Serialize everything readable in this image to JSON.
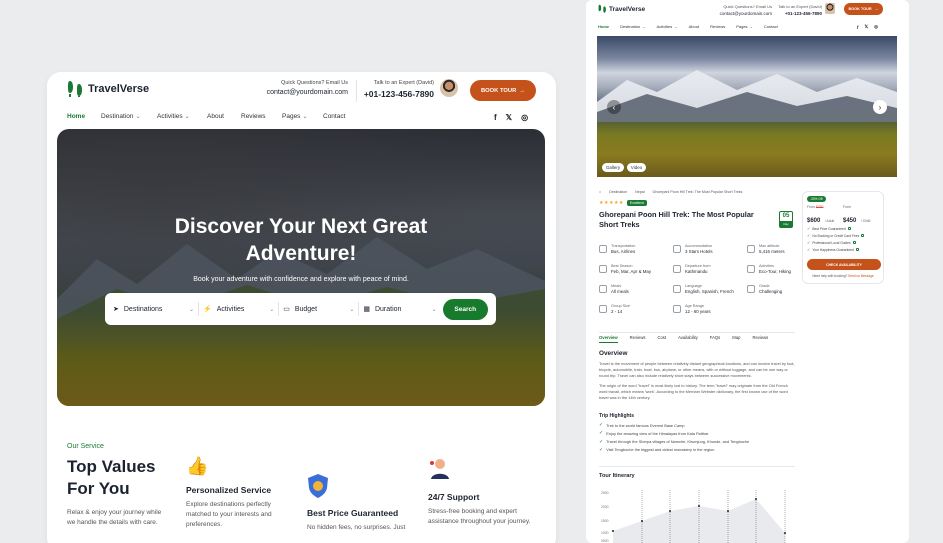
{
  "left": {
    "brand": "TravelVerse",
    "quick_label": "Quick Questions? Email Us",
    "email": "contact@yourdomain.com",
    "expert_label": "Talk to an Expert (David)",
    "phone": "+01-123-456-7890",
    "book_label": "BOOK TOUR",
    "nav": [
      {
        "label": "Home",
        "active": true
      },
      {
        "label": "Destination",
        "caret": true
      },
      {
        "label": "Activities",
        "caret": true
      },
      {
        "label": "About"
      },
      {
        "label": "Reviews"
      },
      {
        "label": "Pages",
        "caret": true
      },
      {
        "label": "Contact"
      }
    ],
    "socials": [
      "facebook-icon",
      "twitter-icon",
      "instagram-icon"
    ],
    "hero": {
      "title_line1": "Discover Your Next Great",
      "title_line2": "Adventure!",
      "subtitle": "Book your adventure with confidence and explore with peace of mind."
    },
    "search": {
      "destinations": "Destinations",
      "activities": "Activities",
      "budget": "Budget",
      "duration": "Duration",
      "button": "Search"
    },
    "service": {
      "eyebrow": "Our Service",
      "title_line1": "Top Values",
      "title_line2": "For You",
      "desc": "Relax & enjoy your journey while we handle the details with care.",
      "items": [
        {
          "icon": "thumbs-up-icon",
          "title": "Personalized Service",
          "desc": "Explore destinations perfectly matched to your interests and preferences."
        },
        {
          "icon": "shield-coin-icon",
          "title": "Best Price Guaranteed",
          "desc": "No hidden fees, no surprises. Just"
        },
        {
          "icon": "support-agent-icon",
          "title": "24/7 Support",
          "desc": "Stress-free booking and expert assistance throughout your journey."
        }
      ]
    }
  },
  "right": {
    "brand": "TravelVerse",
    "quick_label": "Quick Questions? Email Us",
    "email": "contact@yourdomain.com",
    "expert_label": "Talk to an Expert (David)",
    "phone": "+01-123-456-7890",
    "book_label": "BOOK TOUR",
    "nav": [
      "Home",
      "Destination",
      "Activities",
      "About",
      "Reviews",
      "Pages",
      "Contact"
    ],
    "media_pills": [
      "Gallery",
      "Video"
    ],
    "breadcrumb": [
      "Destination",
      "Nepal",
      "Ghorepani Poon Hill Trek: The Most Popular Short Treks"
    ],
    "rating_badge": "Excellent",
    "title_line1": "Ghorepani Poon Hill Trek: The Most Popular",
    "title_line2": "Short Treks",
    "days_num": "05",
    "days_label": "Day",
    "facts": [
      {
        "label": "Transportation",
        "value": "Bus, Airlines"
      },
      {
        "label": "Accommodation",
        "value": "3 Stars Hotels"
      },
      {
        "label": "Max altitude",
        "value": "5,416 meters"
      },
      {
        "label": "Best Season",
        "value": "Feb, Mar, Apr & May"
      },
      {
        "label": "Departure from",
        "value": "Kathmandu"
      },
      {
        "label": "Activities",
        "value": "Eco-Tour, Hiking"
      },
      {
        "label": "Meals",
        "value": "All meals"
      },
      {
        "label": "Language",
        "value": "English, Spanish, French"
      },
      {
        "label": "Grade",
        "value": "Challenging"
      },
      {
        "label": "Group Size",
        "value": "2 - 14"
      },
      {
        "label": "Age Range",
        "value": "12 - 60 years"
      }
    ],
    "tabs": [
      "Overview",
      "Reviews",
      "Cost",
      "Availability",
      "FAQs",
      "Map",
      "Reviews"
    ],
    "overview_title": "Overview",
    "overview_p1": "Travel is the movement of people between relatively distant geographical locations, and can involve travel by foot, bicycle, automobile, train, boat, bus, airplane, or other means, with or without luggage, and can be one way or round trip. Travel can also include relatively short stays between successive movements.",
    "overview_p2": "The origin of the word \"travel\" is most likely lost to history. The term \"travel\" may originate from the Old French word travail, which means 'work'. According to the Merriam Webster dictionary, the first known use of the word travel was in the 14th century.",
    "highlights_title": "Trip Highlights",
    "highlights": [
      "Trek to the world famous Everest Base Camp",
      "Enjoy the amazing view of the Himalayas from Kala Patthar",
      "Travel through the Sherpa villages of Namche, Khumjung, Khunde, and Tengboche",
      "Visit Tengboche the biggest and oldest monastery in the region"
    ],
    "itinerary_title": "Tour Itinerary",
    "itinerary_ticks": [
      "2500",
      "2000",
      "1500",
      "1000",
      "0500"
    ],
    "booking": {
      "badge": "-30% Off",
      "adult_label": "From",
      "adult_old": "$750",
      "adult_price": "$600",
      "adult_unit": "/ Adult",
      "child_label": "From",
      "child_price": "$450",
      "child_unit": "/ Child",
      "features": [
        "Best Price Guaranteed",
        "No Booking or Credit Card Fees",
        "Professional Local Guides",
        "Your Happiness Guaranteed"
      ],
      "cta": "CHECK AVAILABILITY",
      "help": "Need help with booking?",
      "help_link": "Send us Message"
    }
  }
}
